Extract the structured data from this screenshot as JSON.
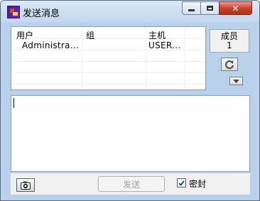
{
  "window": {
    "title": "发送消息"
  },
  "user_table": {
    "columns": [
      "用户",
      "组",
      "主机"
    ],
    "rows": [
      [
        "Administra...",
        "",
        "USER..."
      ]
    ]
  },
  "members": {
    "label": "成员",
    "count": "1"
  },
  "icons": {
    "app": "app-icon",
    "refresh": "refresh-icon",
    "dropdown": "triangle-down-icon",
    "screenshot": "camera-icon",
    "check": "checkmark-icon"
  },
  "message": {
    "value": ""
  },
  "bottom": {
    "send_label": "发送",
    "secret_label": "密封",
    "secret_checked": true
  },
  "colors": {
    "title_bar": "#c3d7ee",
    "close_button": "#c7432b"
  }
}
